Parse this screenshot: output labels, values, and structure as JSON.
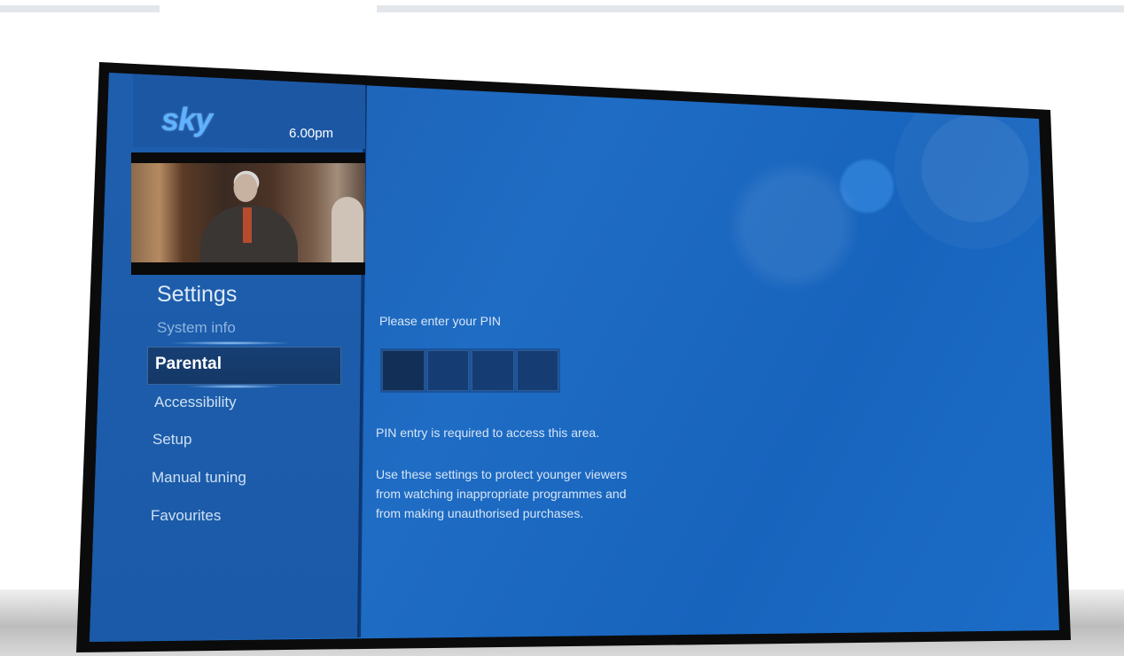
{
  "brand": {
    "logo_text": "sky",
    "clock": "6.00pm"
  },
  "menu": {
    "title": "Settings",
    "items": [
      {
        "label": "System info",
        "state": "faded"
      },
      {
        "label": "Parental",
        "state": "selected"
      },
      {
        "label": "Accessibility",
        "state": "normal"
      },
      {
        "label": "Setup",
        "state": "normal"
      },
      {
        "label": "Manual tuning",
        "state": "normal"
      },
      {
        "label": "Favourites",
        "state": "normal"
      }
    ]
  },
  "pin": {
    "prompt": "Please enter your PIN",
    "digits": [
      "",
      "",
      "",
      ""
    ],
    "note": "PIN entry is required to access this area.",
    "description_lines": [
      "Use these settings to protect younger viewers",
      "from watching inappropriate programmes and",
      "from making unauthorised purchases."
    ]
  },
  "colors": {
    "screen_blue": "#1f6cc4",
    "selection": "#143866",
    "logo_blue": "#5fb2ff"
  }
}
